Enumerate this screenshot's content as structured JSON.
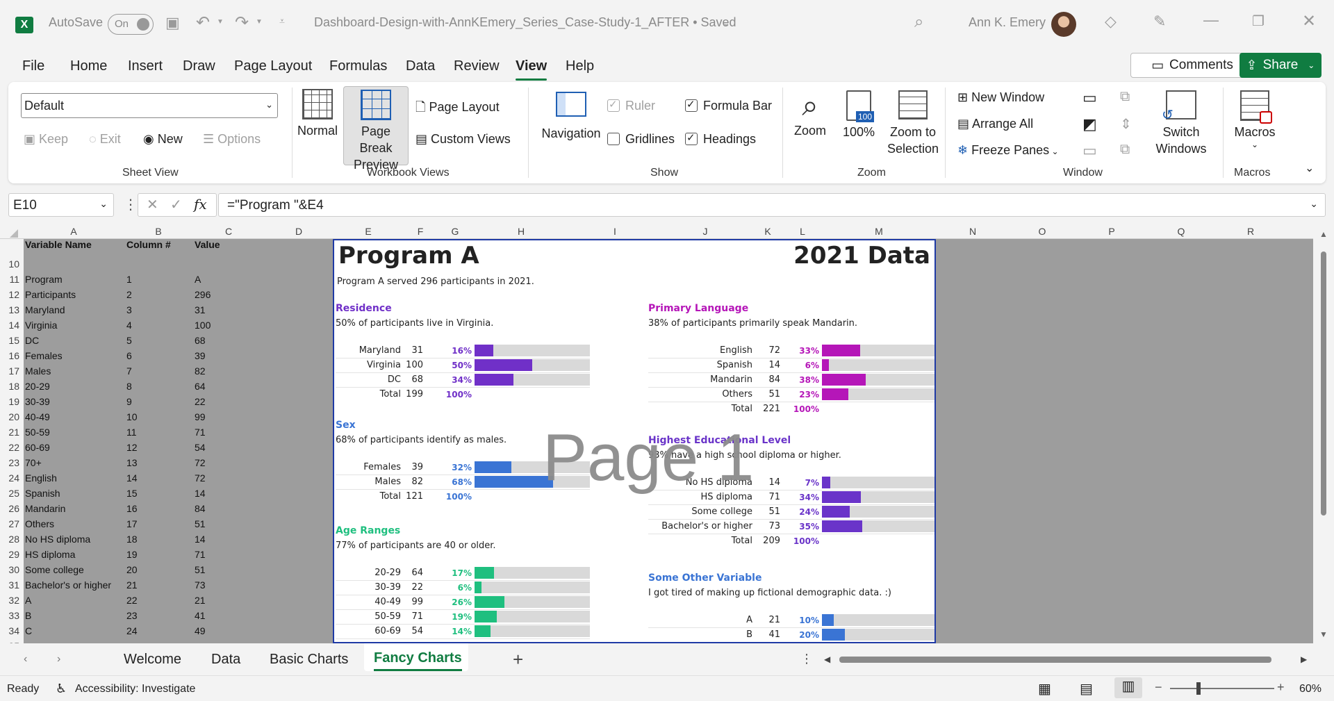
{
  "titlebar": {
    "autosave_label": "AutoSave",
    "autosave_state": "On",
    "filename": "Dashboard-Design-with-AnnKEmery_Series_Case-Study-1_AFTER • Saved",
    "user": "Ann K. Emery"
  },
  "menu": [
    "File",
    "Home",
    "Insert",
    "Draw",
    "Page Layout",
    "Formulas",
    "Data",
    "Review",
    "View",
    "Help"
  ],
  "menu_active": "View",
  "comments_label": "Comments",
  "share_label": "Share",
  "ribbon": {
    "sheet_view_select": "Default",
    "keep": "Keep",
    "exit": "Exit",
    "new": "New",
    "options": "Options",
    "sheet_view_group": "Sheet View",
    "normal": "Normal",
    "page_break_preview": "Page Break Preview",
    "page_layout": "Page Layout",
    "custom_views": "Custom Views",
    "workbook_views_group": "Workbook Views",
    "navigation": "Navigation",
    "ruler": "Ruler",
    "gridlines": "Gridlines",
    "formula_bar": "Formula Bar",
    "headings": "Headings",
    "show_group": "Show",
    "zoom": "Zoom",
    "zoom_100": "100%",
    "zoom_to_selection": "Zoom to Selection",
    "zoom_group": "Zoom",
    "new_window": "New Window",
    "arrange_all": "Arrange All",
    "freeze_panes": "Freeze Panes",
    "switch_windows": "Switch Windows",
    "window_group": "Window",
    "macros": "Macros",
    "macros_group": "Macros"
  },
  "formula_bar": {
    "name_box": "E10",
    "formula": "=\"Program \"&E4"
  },
  "columns": [
    "A",
    "B",
    "C",
    "D",
    "E",
    "F",
    "G",
    "H",
    "I",
    "J",
    "K",
    "L",
    "M",
    "N",
    "O",
    "P",
    "Q",
    "R"
  ],
  "rows": [
    "10",
    "11",
    "12",
    "13",
    "14",
    "15",
    "16",
    "17",
    "18",
    "19",
    "20",
    "21",
    "22",
    "23",
    "24",
    "25",
    "26",
    "27",
    "28",
    "29",
    "30",
    "31",
    "32",
    "33",
    "34",
    "35"
  ],
  "table_headers": [
    "Variable Name",
    "Column #",
    "Value"
  ],
  "table_rows": [
    [
      "Program",
      "1",
      "A"
    ],
    [
      "Participants",
      "2",
      "296"
    ],
    [
      "Maryland",
      "3",
      "31"
    ],
    [
      "Virginia",
      "4",
      "100"
    ],
    [
      "DC",
      "5",
      "68"
    ],
    [
      "Females",
      "6",
      "39"
    ],
    [
      "Males",
      "7",
      "82"
    ],
    [
      "20-29",
      "8",
      "64"
    ],
    [
      "30-39",
      "9",
      "22"
    ],
    [
      "40-49",
      "10",
      "99"
    ],
    [
      "50-59",
      "11",
      "71"
    ],
    [
      "60-69",
      "12",
      "54"
    ],
    [
      "70+",
      "13",
      "72"
    ],
    [
      "English",
      "14",
      "72"
    ],
    [
      "Spanish",
      "15",
      "14"
    ],
    [
      "Mandarin",
      "16",
      "84"
    ],
    [
      "Others",
      "17",
      "51"
    ],
    [
      "No HS diploma",
      "18",
      "14"
    ],
    [
      "HS diploma",
      "19",
      "71"
    ],
    [
      "Some college",
      "20",
      "51"
    ],
    [
      "Bachelor's or higher",
      "21",
      "73"
    ],
    [
      "A",
      "22",
      "21"
    ],
    [
      "B",
      "23",
      "41"
    ],
    [
      "C",
      "24",
      "49"
    ]
  ],
  "dashboard": {
    "title": "Program A",
    "year_title": "2021 Data",
    "subtitle": "Program A served 296 participants in 2021.",
    "watermark": "Page 1",
    "sections": [
      {
        "title": "Residence",
        "color": "#7030c8",
        "sub": "50% of participants live in Virginia.",
        "rows": [
          {
            "label": "Maryland",
            "n": "31",
            "pct": "16%",
            "value": 16
          },
          {
            "label": "Virginia",
            "n": "100",
            "pct": "50%",
            "value": 50
          },
          {
            "label": "DC",
            "n": "68",
            "pct": "34%",
            "value": 34
          }
        ],
        "total": {
          "label": "Total",
          "n": "199",
          "pct": "100%"
        }
      },
      {
        "title": "Sex",
        "color": "#3a74d4",
        "sub": "68% of participants identify as males.",
        "rows": [
          {
            "label": "Females",
            "n": "39",
            "pct": "32%",
            "value": 32
          },
          {
            "label": "Males",
            "n": "82",
            "pct": "68%",
            "value": 68
          }
        ],
        "total": {
          "label": "Total",
          "n": "121",
          "pct": "100%"
        }
      },
      {
        "title": "Age Ranges",
        "color": "#1fbf7f",
        "sub": "77% of participants are 40 or older.",
        "rows": [
          {
            "label": "20-29",
            "n": "64",
            "pct": "17%",
            "value": 17
          },
          {
            "label": "30-39",
            "n": "22",
            "pct": "6%",
            "value": 6
          },
          {
            "label": "40-49",
            "n": "99",
            "pct": "26%",
            "value": 26
          },
          {
            "label": "50-59",
            "n": "71",
            "pct": "19%",
            "value": 19
          },
          {
            "label": "60-69",
            "n": "54",
            "pct": "14%",
            "value": 14
          }
        ],
        "total": null
      },
      {
        "title": "Primary Language",
        "color": "#b516b8",
        "sub": "38% of participants primarily speak Mandarin.",
        "rows": [
          {
            "label": "English",
            "n": "72",
            "pct": "33%",
            "value": 33
          },
          {
            "label": "Spanish",
            "n": "14",
            "pct": "6%",
            "value": 6
          },
          {
            "label": "Mandarin",
            "n": "84",
            "pct": "38%",
            "value": 38
          },
          {
            "label": "Others",
            "n": "51",
            "pct": "23%",
            "value": 23
          }
        ],
        "total": {
          "label": "Total",
          "n": "221",
          "pct": "100%"
        }
      },
      {
        "title": "Highest Educational Level",
        "color": "#6a34c9",
        "sub": "93% have a high school diploma or higher.",
        "rows": [
          {
            "label": "No HS diploma",
            "n": "14",
            "pct": "7%",
            "value": 7
          },
          {
            "label": "HS diploma",
            "n": "71",
            "pct": "34%",
            "value": 34
          },
          {
            "label": "Some college",
            "n": "51",
            "pct": "24%",
            "value": 24
          },
          {
            "label": "Bachelor's or higher",
            "n": "73",
            "pct": "35%",
            "value": 35
          }
        ],
        "total": {
          "label": "Total",
          "n": "209",
          "pct": "100%"
        }
      },
      {
        "title": "Some Other Variable",
        "color": "#3a74d4",
        "sub": "I got tired of making up fictional demographic data. :)",
        "rows": [
          {
            "label": "A",
            "n": "21",
            "pct": "10%",
            "value": 10
          },
          {
            "label": "B",
            "n": "41",
            "pct": "20%",
            "value": 20
          }
        ],
        "total": null
      }
    ]
  },
  "sheet_tabs": [
    "Welcome",
    "Data",
    "Basic Charts",
    "Fancy Charts"
  ],
  "active_tab": "Fancy Charts",
  "status": {
    "ready": "Ready",
    "accessibility": "Accessibility: Investigate",
    "zoom": "60%"
  }
}
